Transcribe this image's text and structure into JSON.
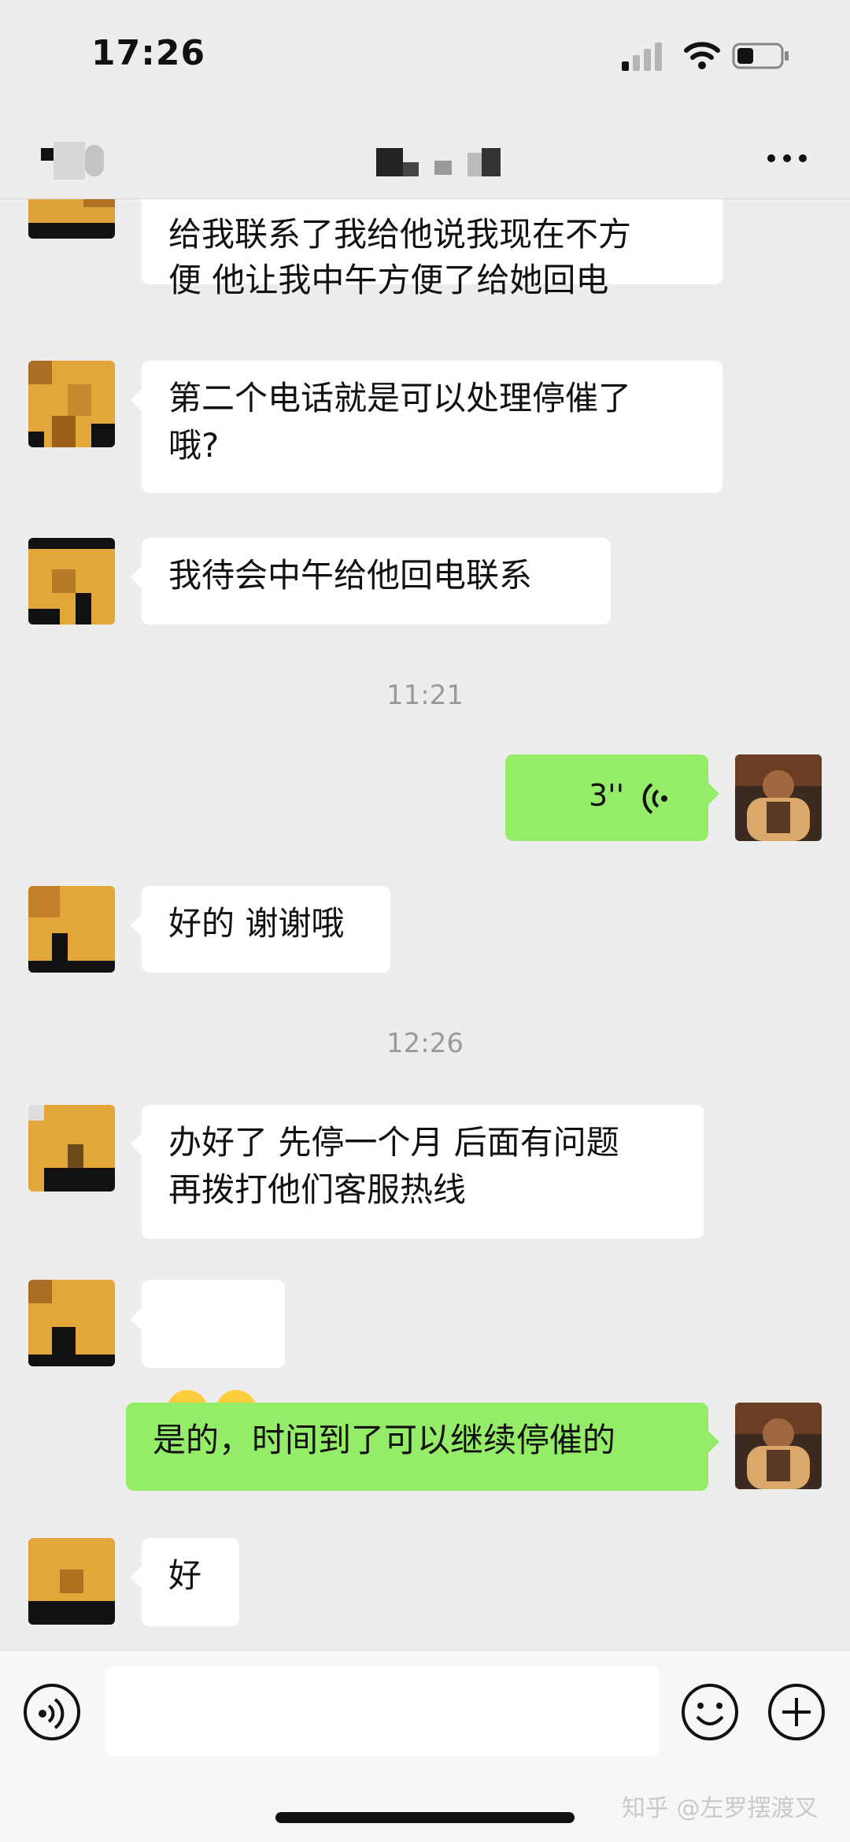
{
  "status_bar": {
    "time": "17:26"
  },
  "header": {
    "title": ""
  },
  "messages": {
    "m1": "给我联系了我给他说我现在不方\n便 他让我中午方便了给她回电",
    "m2": "第二个电话就是可以处理停催了\n哦?",
    "m3": "我待会中午给他回电联系",
    "ts1": "11:21",
    "voice_duration": "3''",
    "m5": "好的 谢谢哦",
    "ts2": "12:26",
    "m6": "办好了 先停一个月 后面有问题\n再拨打他们客服热线",
    "m7": "😌😌",
    "m8": "是的，时间到了可以继续停催的",
    "m9": "好"
  },
  "input": {
    "placeholder": ""
  },
  "watermark": "知乎 @左罗摆渡叉",
  "colors": {
    "self_bubble": "#95ec69",
    "other_bubble": "#ffffff",
    "background": "#ededed"
  }
}
